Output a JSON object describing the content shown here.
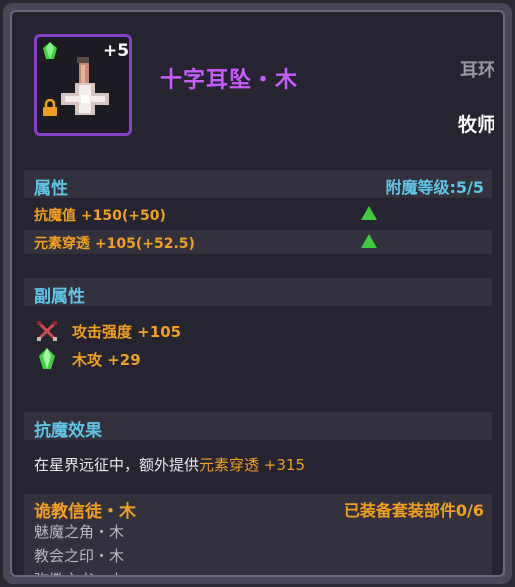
{
  "item": {
    "name": "十字耳坠・木",
    "slot": "耳环",
    "class": "牧师",
    "enhance_level": "+5",
    "rarity_color": "#8a3fc8"
  },
  "attributes": {
    "header": "属性",
    "enchant_label": "附魔等级:5/5",
    "stats": [
      {
        "label": "抗魔值 +150(+50)",
        "trend": "up"
      },
      {
        "label": "元素穿透 +105(+52.5)",
        "trend": "up"
      }
    ]
  },
  "sub_attributes": {
    "header": "副属性",
    "stats": [
      {
        "icon": "crossed-swords-icon",
        "label": "攻击强度 +105"
      },
      {
        "icon": "green-gem-icon",
        "label": "木攻 +29"
      }
    ]
  },
  "effect": {
    "header": "抗魔效果",
    "text_prefix": "在星界远征中，额外提供",
    "text_highlight": "元素穿透 +315"
  },
  "set": {
    "name": "诡教信徒・木",
    "progress": "已装备套装部件0/6",
    "items": [
      "魅魔之角・木",
      "教会之印・木",
      "弥撒之书・木"
    ]
  },
  "colors": {
    "title": "#c95bff",
    "header": "#5fc6e6",
    "stat": "#f0a020",
    "up_arrow": "#3ecb3e"
  }
}
